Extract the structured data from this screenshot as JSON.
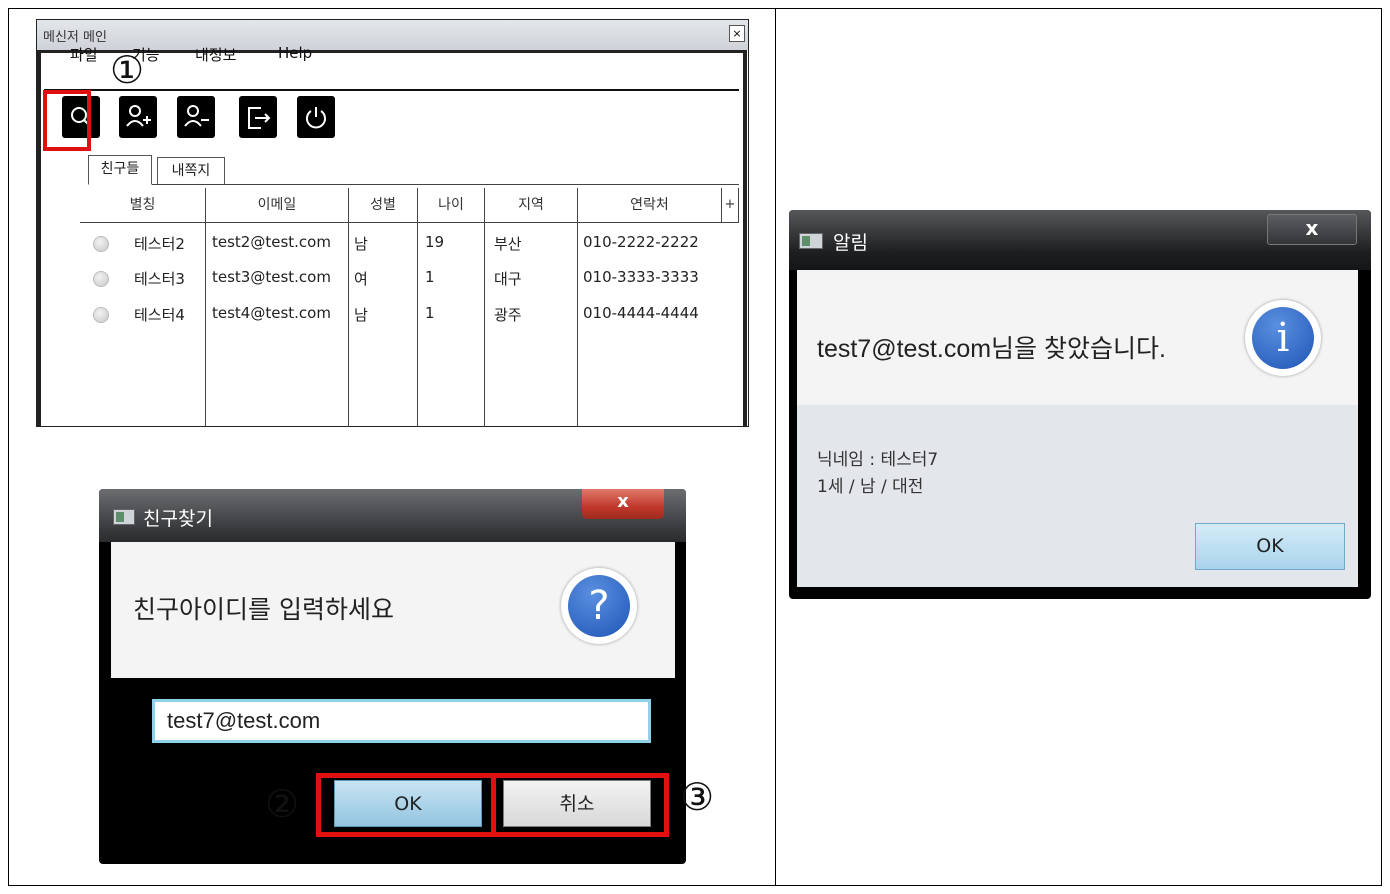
{
  "main_window": {
    "title": "메신저 메인",
    "close": "×",
    "menu": [
      "파일",
      "기능",
      "내정보",
      "Help"
    ],
    "toolbar_icons": [
      "search-icon",
      "add-user-icon",
      "remove-user-icon",
      "logout-icon",
      "power-icon"
    ],
    "tabs": [
      "친구들",
      "내쪽지"
    ],
    "columns": [
      "별칭",
      "이메일",
      "성별",
      "나이",
      "지역",
      "연락처",
      "+"
    ],
    "rows": [
      {
        "nick": "테스터2",
        "email": "test2@test.com",
        "gender": "남",
        "age": "19",
        "region": "부산",
        "phone": "010-2222-2222"
      },
      {
        "nick": "테스터3",
        "email": "test3@test.com",
        "gender": "여",
        "age": "1",
        "region": "대구",
        "phone": "010-3333-3333"
      },
      {
        "nick": "테스터4",
        "email": "test4@test.com",
        "gender": "남",
        "age": "1",
        "region": "광주",
        "phone": "010-4444-4444"
      }
    ]
  },
  "annotations": {
    "step1": "①",
    "step2": "②",
    "step3": "③"
  },
  "find_dialog": {
    "title": "친구찾기",
    "close": "x",
    "message": "친구아이디를 입력하세요",
    "input_value": "test7@test.com",
    "ok_label": "OK",
    "cancel_label": "취소"
  },
  "alert_dialog": {
    "title": "알림",
    "close": "x",
    "message": "test7@test.com님을 찾았습니다.",
    "detail_line1": "닉네임 : 테스터7",
    "detail_line2": "1세 / 남 / 대전",
    "ok_label": "OK"
  },
  "colors": {
    "highlight": "#e01010",
    "info_blue": "#1f56b5"
  }
}
